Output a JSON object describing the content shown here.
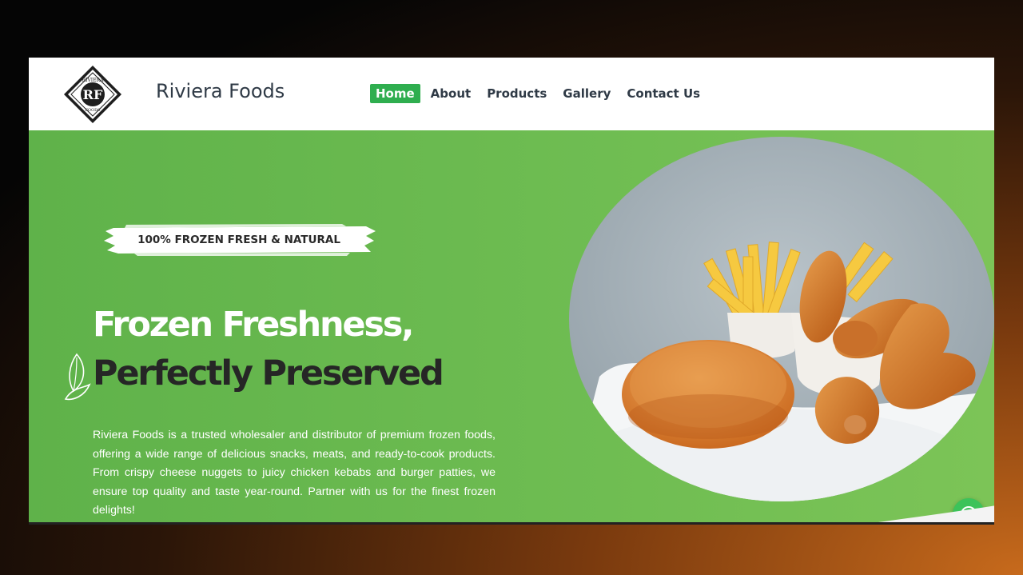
{
  "header": {
    "logo_text_top": "RIVIERA",
    "logo_text_bottom": "FOODS",
    "logo_monogram": "RF",
    "brand_name": "Riviera Foods",
    "nav": [
      {
        "label": "Home",
        "active": true
      },
      {
        "label": "About",
        "active": false
      },
      {
        "label": "Products",
        "active": false
      },
      {
        "label": "Gallery",
        "active": false
      },
      {
        "label": "Contact Us",
        "active": false
      }
    ]
  },
  "hero": {
    "badge": "100% FROZEN FRESH & NATURAL",
    "title_line1": "Frozen Freshness,",
    "title_line2": "Perfectly Preserved",
    "description": "Riviera Foods is a trusted wholesaler and distributor of premium frozen foods, offering a wide range of delicious snacks, meats, and ready-to-cook products. From crispy cheese nuggets to juicy chicken kebabs and burger patties, we ensure top quality and taste year-round. Partner with us for the finest frozen delights!"
  },
  "floating": {
    "icon": "whatsapp-icon"
  },
  "colors": {
    "accent": "#2fae4f",
    "hero_bg": "#6fbd52",
    "nav_text": "#2f3a46",
    "title_dark": "#262626"
  }
}
